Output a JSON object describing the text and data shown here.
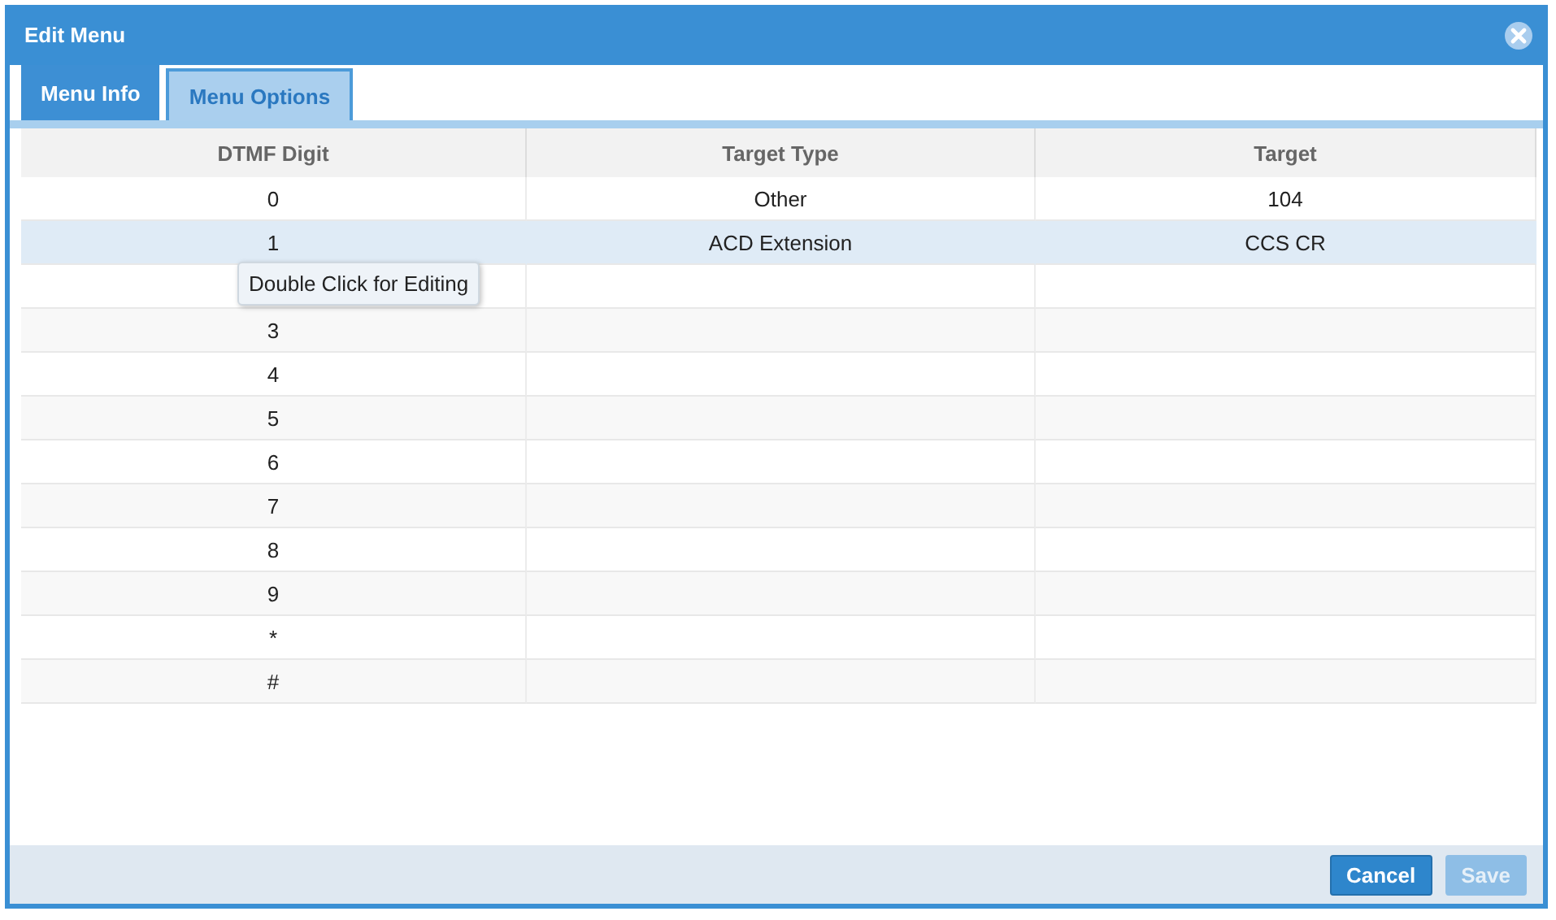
{
  "window": {
    "title": "Edit Menu"
  },
  "tabs": [
    {
      "label": "Menu Info",
      "selected": false
    },
    {
      "label": "Menu Options",
      "selected": true
    }
  ],
  "table": {
    "columns": [
      "DTMF Digit",
      "Target Type",
      "Target"
    ],
    "rows": [
      {
        "digit": "0",
        "target_type": "Other",
        "target": "104",
        "selected": false
      },
      {
        "digit": "1",
        "target_type": "ACD Extension",
        "target": "CCS CR",
        "selected": true
      },
      {
        "selected": false
      },
      {
        "digit": "3",
        "selected": false
      },
      {
        "digit": "4",
        "selected": false
      },
      {
        "digit": "5",
        "selected": false
      },
      {
        "digit": "6",
        "selected": false
      },
      {
        "digit": "7",
        "selected": false
      },
      {
        "digit": "8",
        "selected": false
      },
      {
        "digit": "9",
        "selected": false
      },
      {
        "digit": "*",
        "selected": false
      },
      {
        "digit": "#",
        "selected": false
      }
    ]
  },
  "tooltip": {
    "text": "Double Click for Editing"
  },
  "buttons": [
    {
      "label": "Cancel",
      "disabled": false
    },
    {
      "label": "Save",
      "disabled": true
    }
  ]
}
